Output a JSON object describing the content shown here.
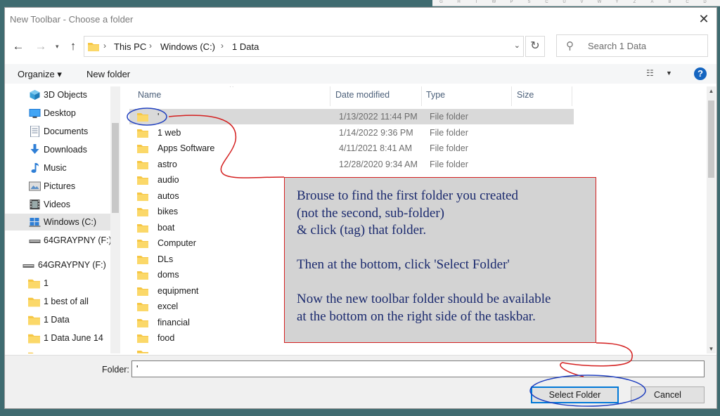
{
  "window": {
    "title": "New Toolbar - Choose a folder"
  },
  "nav": {
    "back": "←",
    "forward": "→",
    "up": "↑"
  },
  "address": {
    "crumbs": [
      "This PC",
      "Windows (C:)",
      "1 Data"
    ]
  },
  "search": {
    "placeholder": "Search 1 Data"
  },
  "toolbar": {
    "organize": "Organize ▾",
    "new_folder": "New folder",
    "help": "?"
  },
  "sidebar": {
    "items": [
      {
        "label": "3D Objects"
      },
      {
        "label": "Desktop"
      },
      {
        "label": "Documents"
      },
      {
        "label": "Downloads"
      },
      {
        "label": "Music"
      },
      {
        "label": "Pictures"
      },
      {
        "label": "Videos"
      },
      {
        "label": "Windows (C:)"
      },
      {
        "label": "64GRAYPNY (F:)"
      },
      {
        "label": "64GRAYPNY (F:)"
      },
      {
        "label": "1"
      },
      {
        "label": "1 best of all"
      },
      {
        "label": "1 Data"
      },
      {
        "label": "1 Data June 14"
      }
    ]
  },
  "columns": {
    "name": "Name",
    "date": "Date modified",
    "type": "Type",
    "size": "Size"
  },
  "files": [
    {
      "name": "'",
      "date": "1/13/2022 11:44 PM",
      "type": "File folder"
    },
    {
      "name": "1 web",
      "date": "1/14/2022 9:36 PM",
      "type": "File folder"
    },
    {
      "name": "Apps Software",
      "date": "4/11/2021 8:41 AM",
      "type": "File folder"
    },
    {
      "name": "astro",
      "date": "12/28/2020 9:34 AM",
      "type": "File folder"
    },
    {
      "name": "audio",
      "date": "",
      "type": ""
    },
    {
      "name": "autos",
      "date": "",
      "type": ""
    },
    {
      "name": "bikes",
      "date": "",
      "type": ""
    },
    {
      "name": "boat",
      "date": "",
      "type": ""
    },
    {
      "name": "Computer",
      "date": "",
      "type": ""
    },
    {
      "name": "DLs",
      "date": "",
      "type": ""
    },
    {
      "name": "doms",
      "date": "",
      "type": ""
    },
    {
      "name": "equipment",
      "date": "",
      "type": ""
    },
    {
      "name": "excel",
      "date": "",
      "type": ""
    },
    {
      "name": "financial",
      "date": "",
      "type": ""
    },
    {
      "name": "food",
      "date": "",
      "type": ""
    }
  ],
  "footer": {
    "folder_label": "Folder:",
    "folder_value": "'",
    "select_button": "Select Folder",
    "cancel_button": "Cancel"
  },
  "callout": {
    "line1": "Brouse to find the first folder you created",
    "line2": "(not the second, sub-folder)",
    "line3": "& click (tag) that folder.",
    "line4": "Then at the bottom, click 'Select Folder'",
    "line5": "Now the new toolbar folder should be available",
    "line6": "at the bottom on the right side of the taskbar."
  },
  "colors": {
    "accent": "#0078d7",
    "annotation_red": "#d42020",
    "annotation_blue": "#1f3fbf",
    "folder": "#f6c643",
    "callout_text": "#1b2a6e"
  }
}
